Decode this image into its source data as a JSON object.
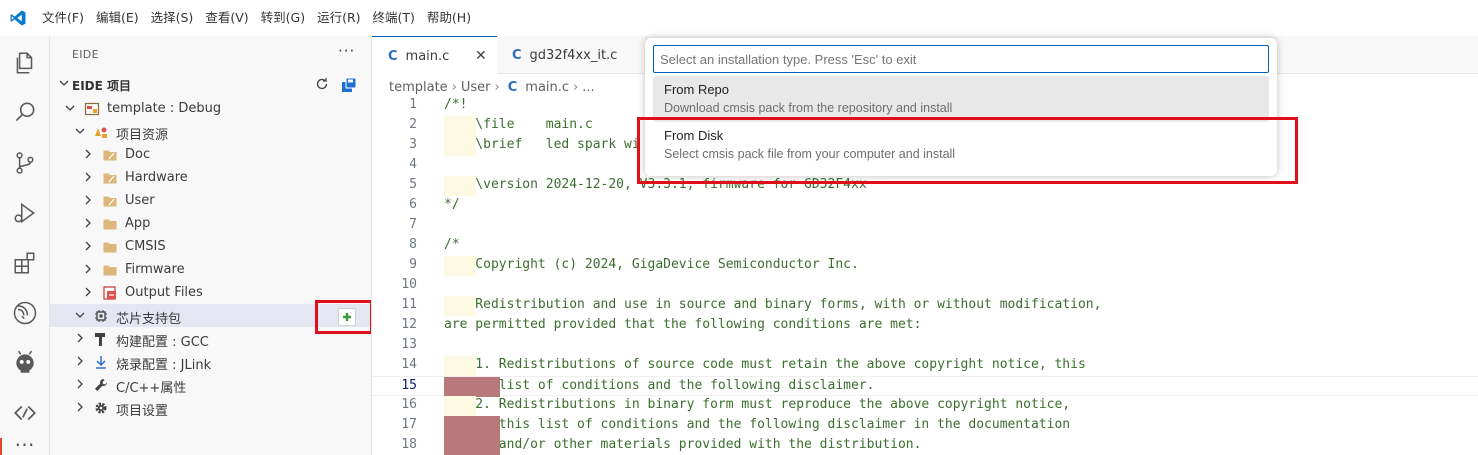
{
  "menu": [
    "文件(F)",
    "编辑(E)",
    "选择(S)",
    "查看(V)",
    "转到(G)",
    "运行(R)",
    "终端(T)",
    "帮助(H)"
  ],
  "sidebar": {
    "title": "EIDE",
    "section_title": "EIDE 项目",
    "tree": [
      {
        "label": "template : Debug"
      },
      {
        "label": "项目资源"
      },
      {
        "label": "Doc"
      },
      {
        "label": "Hardware"
      },
      {
        "label": "User"
      },
      {
        "label": "App"
      },
      {
        "label": "CMSIS"
      },
      {
        "label": "Firmware"
      },
      {
        "label": "Output Files"
      },
      {
        "label": "芯片支持包"
      },
      {
        "label": "构建配置 : GCC"
      },
      {
        "label": "烧录配置 : JLink"
      },
      {
        "label": "C/C++属性"
      },
      {
        "label": "项目设置"
      }
    ]
  },
  "tabs": [
    {
      "label": "main.c",
      "active": true
    },
    {
      "label": "gd32f4xx_it.c",
      "active": false
    }
  ],
  "breadcrumb": {
    "p1": "template",
    "p2": "User",
    "p3": "main.c",
    "p4": "..."
  },
  "code_lines": [
    {
      "n": "1",
      "text": "/*!"
    },
    {
      "n": "2",
      "text": "    \\file    main.c"
    },
    {
      "n": "3",
      "text": "    \\brief   led spark wi"
    },
    {
      "n": "4",
      "text": ""
    },
    {
      "n": "5",
      "text": "    \\version 2024-12-20, V3.3.1, firmware for GD32F4xx"
    },
    {
      "n": "6",
      "text": "*/"
    },
    {
      "n": "7",
      "text": ""
    },
    {
      "n": "8",
      "text": "/*"
    },
    {
      "n": "9",
      "text": "    Copyright (c) 2024, GigaDevice Semiconductor Inc."
    },
    {
      "n": "10",
      "text": ""
    },
    {
      "n": "11",
      "text": "    Redistribution and use in source and binary forms, with or without modification,"
    },
    {
      "n": "12",
      "text": "are permitted provided that the following conditions are met:"
    },
    {
      "n": "13",
      "text": ""
    },
    {
      "n": "14",
      "text": "    1. Redistributions of source code must retain the above copyright notice, this"
    },
    {
      "n": "15",
      "text": "       list of conditions and the following disclaimer."
    },
    {
      "n": "16",
      "text": "    2. Redistributions in binary form must reproduce the above copyright notice,"
    },
    {
      "n": "17",
      "text": "       this list of conditions and the following disclaimer in the documentation"
    },
    {
      "n": "18",
      "text": "       and/or other materials provided with the distribution."
    }
  ],
  "quickpick": {
    "placeholder": "Select an installation type. Press 'Esc' to exit",
    "items": [
      {
        "label": "From Repo",
        "desc": "Download cmsis pack from the repository and install"
      },
      {
        "label": "From Disk",
        "desc": "Select cmsis pack file from your computer and install"
      }
    ]
  },
  "colors": {
    "accent": "#005fb8",
    "highlight": "#e0101a"
  },
  "icons": [
    "vscode-logo-icon",
    "explorer-icon",
    "search-icon",
    "source-control-icon",
    "run-debug-icon",
    "extensions-icon",
    "eide-icon",
    "platformio-icon",
    "remote-icon"
  ]
}
